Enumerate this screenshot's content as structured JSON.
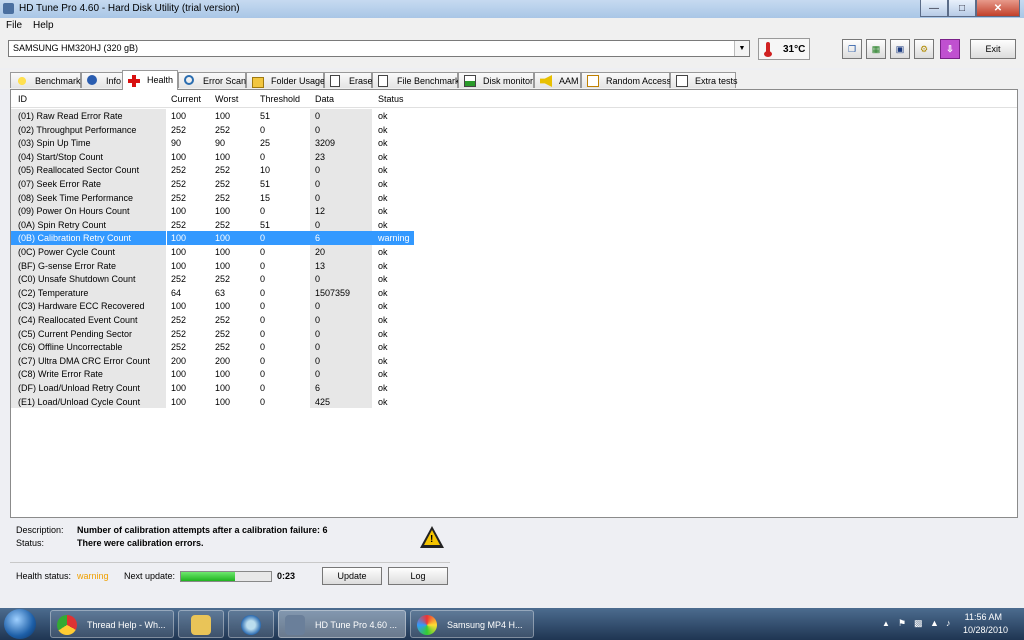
{
  "window": {
    "title": "HD Tune Pro 4.60 - Hard Disk Utility (trial version)"
  },
  "menu": [
    "File",
    "Help"
  ],
  "drive": {
    "selected": "SAMSUNG HM320HJ (320 gB)"
  },
  "temperature": "31°C",
  "toolbar": {
    "exit_label": "Exit"
  },
  "tabs": [
    "Benchmark",
    "Info",
    "Health",
    "Error Scan",
    "Folder Usage",
    "Erase",
    "File Benchmark",
    "Disk monitor",
    "AAM",
    "Random Access",
    "Extra tests"
  ],
  "active_tab": "Health",
  "table": {
    "headers": [
      "ID",
      "Current",
      "Worst",
      "Threshold",
      "Data",
      "Status"
    ],
    "rows": [
      [
        "(01) Raw Read Error Rate",
        "100",
        "100",
        "51",
        "0",
        "ok"
      ],
      [
        "(02) Throughput Performance",
        "252",
        "252",
        "0",
        "0",
        "ok"
      ],
      [
        "(03) Spin Up Time",
        "90",
        "90",
        "25",
        "3209",
        "ok"
      ],
      [
        "(04) Start/Stop Count",
        "100",
        "100",
        "0",
        "23",
        "ok"
      ],
      [
        "(05) Reallocated Sector Count",
        "252",
        "252",
        "10",
        "0",
        "ok"
      ],
      [
        "(07) Seek Error Rate",
        "252",
        "252",
        "51",
        "0",
        "ok"
      ],
      [
        "(08) Seek Time Performance",
        "252",
        "252",
        "15",
        "0",
        "ok"
      ],
      [
        "(09) Power On Hours Count",
        "100",
        "100",
        "0",
        "12",
        "ok"
      ],
      [
        "(0A) Spin Retry Count",
        "252",
        "252",
        "51",
        "0",
        "ok"
      ],
      [
        "(0B) Calibration Retry Count",
        "100",
        "100",
        "0",
        "6",
        "warning"
      ],
      [
        "(0C) Power Cycle Count",
        "100",
        "100",
        "0",
        "20",
        "ok"
      ],
      [
        "(BF) G-sense Error Rate",
        "100",
        "100",
        "0",
        "13",
        "ok"
      ],
      [
        "(C0) Unsafe Shutdown Count",
        "252",
        "252",
        "0",
        "0",
        "ok"
      ],
      [
        "(C2) Temperature",
        "64",
        "63",
        "0",
        "1507359",
        "ok"
      ],
      [
        "(C3) Hardware ECC Recovered",
        "100",
        "100",
        "0",
        "0",
        "ok"
      ],
      [
        "(C4) Reallocated Event Count",
        "252",
        "252",
        "0",
        "0",
        "ok"
      ],
      [
        "(C5) Current Pending Sector",
        "252",
        "252",
        "0",
        "0",
        "ok"
      ],
      [
        "(C6) Offline Uncorrectable",
        "252",
        "252",
        "0",
        "0",
        "ok"
      ],
      [
        "(C7) Ultra DMA CRC Error Count",
        "200",
        "200",
        "0",
        "0",
        "ok"
      ],
      [
        "(C8) Write Error Rate",
        "100",
        "100",
        "0",
        "0",
        "ok"
      ],
      [
        "(DF) Load/Unload Retry Count",
        "100",
        "100",
        "0",
        "6",
        "ok"
      ],
      [
        "(E1) Load/Unload Cycle Count",
        "100",
        "100",
        "0",
        "425",
        "ok"
      ]
    ],
    "selected_row": 9
  },
  "details": {
    "description_label": "Description:",
    "description": "Number of calibration attempts after a calibration failure: 6",
    "status_label": "Status:",
    "status": "There were calibration errors."
  },
  "health": {
    "label": "Health status:",
    "value": "warning",
    "next_update_label": "Next update:",
    "progress_fraction": 0.6,
    "countdown": "0:23",
    "update_label": "Update",
    "log_label": "Log"
  },
  "taskbar": {
    "items": [
      "Thread Help - Wh...",
      "",
      "",
      "HD Tune Pro 4.60 ...",
      "Samsung MP4 H..."
    ],
    "time": "11:56 AM",
    "date": "10/28/2010"
  },
  "colors": {
    "selection": "#3399ff",
    "warning": "#f0a000",
    "progress": "#1fb31f"
  }
}
